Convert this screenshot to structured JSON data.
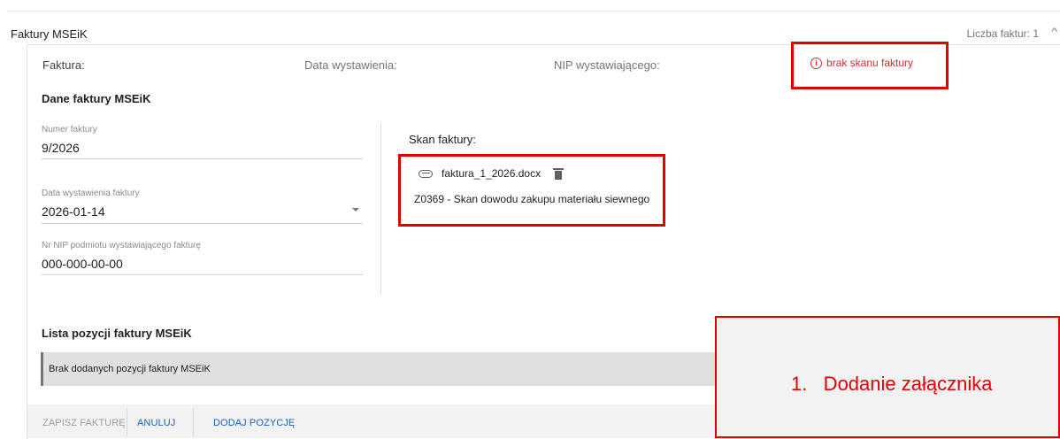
{
  "section": {
    "title": "Faktury MSEiK",
    "count": "Liczba faktur: 1"
  },
  "summary": {
    "faktura_label": "Faktura:",
    "data_label": "Data wystawienia:",
    "nip_label": "NIP wystawiającego:",
    "error_text": "brak skanu faktury"
  },
  "dane": {
    "heading": "Dane faktury MSEiK",
    "numer": {
      "label": "Numer faktury",
      "value": "9/2026"
    },
    "data": {
      "label": "Data wystawienia faktury",
      "value": "2026-01-14"
    },
    "nip": {
      "label": "Nr NIP podmiotu wystawiającego fakturę",
      "value": "000-000-00-00"
    }
  },
  "skan": {
    "label": "Skan faktury:",
    "file_name": "faktura_1_2026.docx",
    "description": "Z0369 - Skan dowodu zakupu materiału siewnego"
  },
  "lista": {
    "heading": "Lista pozycji faktury MSEiK",
    "empty_text": "Brak dodanych pozycji faktury MSEiK"
  },
  "footer": {
    "save": "Zapisz fakturę",
    "cancel": "Anuluj",
    "add": "Dodaj pozycję"
  },
  "annotation": {
    "text": "1.   Dodanie załącznika"
  },
  "colors": {
    "error": "#d32f2f",
    "link": "#1565c0",
    "highlight": "#e00000"
  },
  "icons": {
    "error": "info-circle-icon",
    "file": "paperclip-icon",
    "delete": "trash-icon",
    "select": "dropdown-arrow-icon",
    "collapse": "chevron-up-icon"
  }
}
